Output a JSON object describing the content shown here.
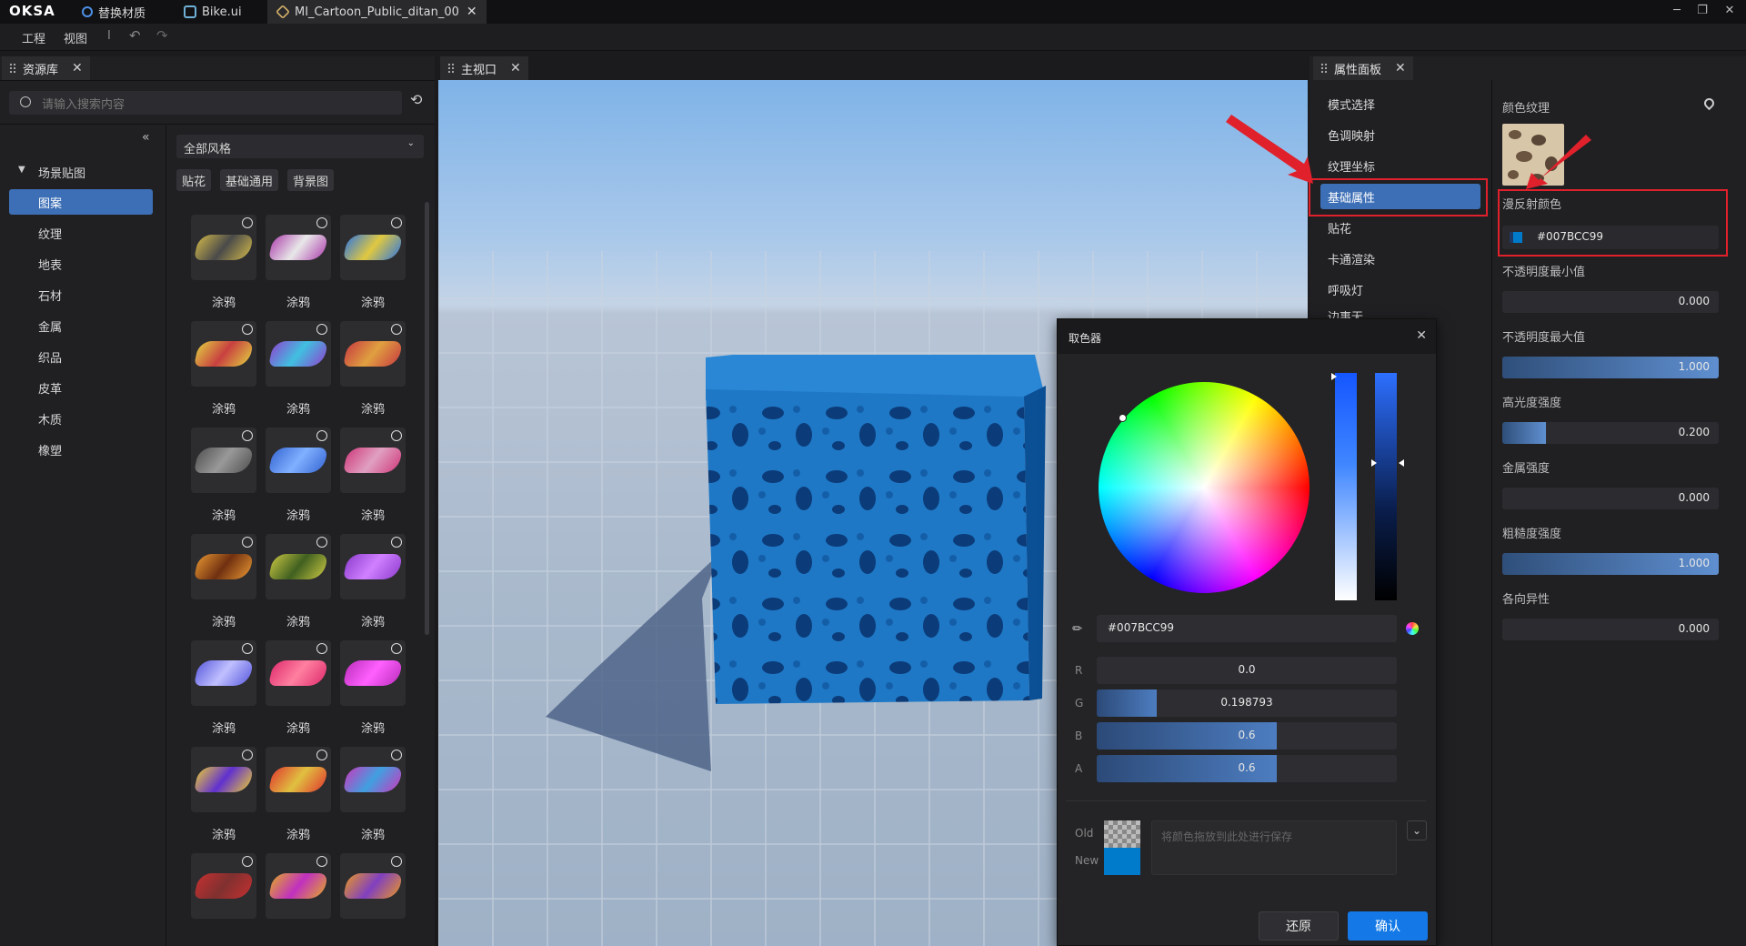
{
  "titlebar": {
    "logo": "OKSA",
    "tabs": [
      {
        "label": "替换材质",
        "icon": "refresh-icon"
      },
      {
        "label": "Bike.ui",
        "icon": "ui-file-icon"
      },
      {
        "label": "MI_Cartoon_Public_ditan_00",
        "icon": "material-cube-icon"
      }
    ]
  },
  "menubar": {
    "items": [
      "工程",
      "视图"
    ],
    "separator": "I"
  },
  "assets": {
    "tab": "资源库",
    "search_placeholder": "请输入搜索内容",
    "tree_root": "场景贴图",
    "categories": [
      "图案",
      "纹理",
      "地表",
      "石材",
      "金属",
      "织品",
      "皮革",
      "木质",
      "橡塑"
    ],
    "style_dropdown": "全部风格",
    "filters": [
      "贴花",
      "基础通用",
      "背景图"
    ],
    "item_label": "涂鸦",
    "rows": 7,
    "cols": 3
  },
  "viewport": {
    "tab": "主视口"
  },
  "props": {
    "tab": "属性面板",
    "sections": [
      "模式选择",
      "色调映射",
      "纹理坐标",
      "基础属性",
      "贴花",
      "卡通渲染",
      "呼吸灯",
      "边事无"
    ],
    "selected": "基础属性",
    "color_texture_label": "颜色纹理",
    "diffuse_label": "漫反射颜色",
    "diffuse_value": "#007BCC99",
    "sliders": [
      {
        "label": "不透明度最小值",
        "value": "0.000",
        "fraction": 0
      },
      {
        "label": "不透明度最大值",
        "value": "1.000",
        "fraction": 1
      },
      {
        "label": "高光度强度",
        "value": "0.200",
        "fraction": 0.2
      },
      {
        "label": "金属强度",
        "value": "0.000",
        "fraction": 0
      },
      {
        "label": "粗糙度强度",
        "value": "1.000",
        "fraction": 1
      },
      {
        "label": "各向异性",
        "value": "0.000",
        "fraction": 0
      }
    ]
  },
  "picker": {
    "title": "取色器",
    "hex": "#007BCC99",
    "channels": [
      {
        "label": "R",
        "value": "0.0",
        "fraction": 0
      },
      {
        "label": "G",
        "value": "0.198793",
        "fraction": 0.198793
      },
      {
        "label": "B",
        "value": "0.6",
        "fraction": 0.6
      },
      {
        "label": "A",
        "value": "0.6",
        "fraction": 0.6
      }
    ],
    "old_label": "Old",
    "new_label": "New",
    "save_hint": "将颜色拖放到此处进行保存",
    "reset_label": "还原",
    "confirm_label": "确认"
  },
  "colors": {
    "accent": "#3d6fb6",
    "diffuse": "#007BCC",
    "highlight_red": "#e0212b",
    "confirm": "#1479e6"
  }
}
